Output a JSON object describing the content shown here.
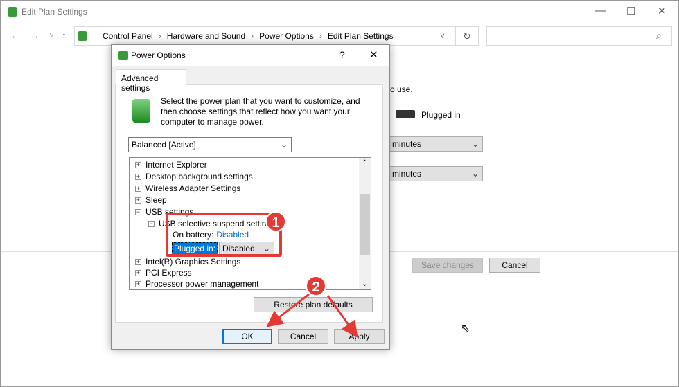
{
  "window": {
    "title": "Edit Plan Settings",
    "minimize": "—",
    "maximize": "☐",
    "close": "✕"
  },
  "nav": {
    "back": "←",
    "forward": "→",
    "recent": "˅",
    "up": "↑",
    "refresh": "↻",
    "dropdown": "˅",
    "search_icon": "⌕",
    "breadcrumbs": [
      "Control Panel",
      "Hardware and Sound",
      "Power Options",
      "Edit Plan Settings"
    ]
  },
  "background": {
    "partial_text": "o use.",
    "plugged_in": "Plugged in",
    "select1": "minutes",
    "select2": "minutes",
    "save": "Save changes",
    "cancel": "Cancel"
  },
  "dialog": {
    "title": "Power Options",
    "help": "?",
    "close": "✕",
    "tab": "Advanced settings",
    "description": "Select the power plan that you want to customize, and then choose settings that reflect how you want your computer to manage power.",
    "plan": "Balanced [Active]",
    "tree": [
      "Internet Explorer",
      "Desktop background settings",
      "Wireless Adapter Settings",
      "Sleep",
      "USB settings",
      "USB selective suspend setting",
      "Intel(R) Graphics Settings",
      "PCI Express",
      "Processor power management"
    ],
    "on_battery_label": "On battery:",
    "on_battery_value": "Disabled",
    "plugged_label": "Plugged in:",
    "plugged_value": "Disabled",
    "restore": "Restore plan defaults",
    "ok": "OK",
    "cancel": "Cancel",
    "apply": "Apply"
  },
  "annotations": {
    "step1": "1",
    "step2": "2"
  },
  "colors": {
    "accent": "#0078d7",
    "link": "#0066cc",
    "annotation": "#e53935"
  }
}
